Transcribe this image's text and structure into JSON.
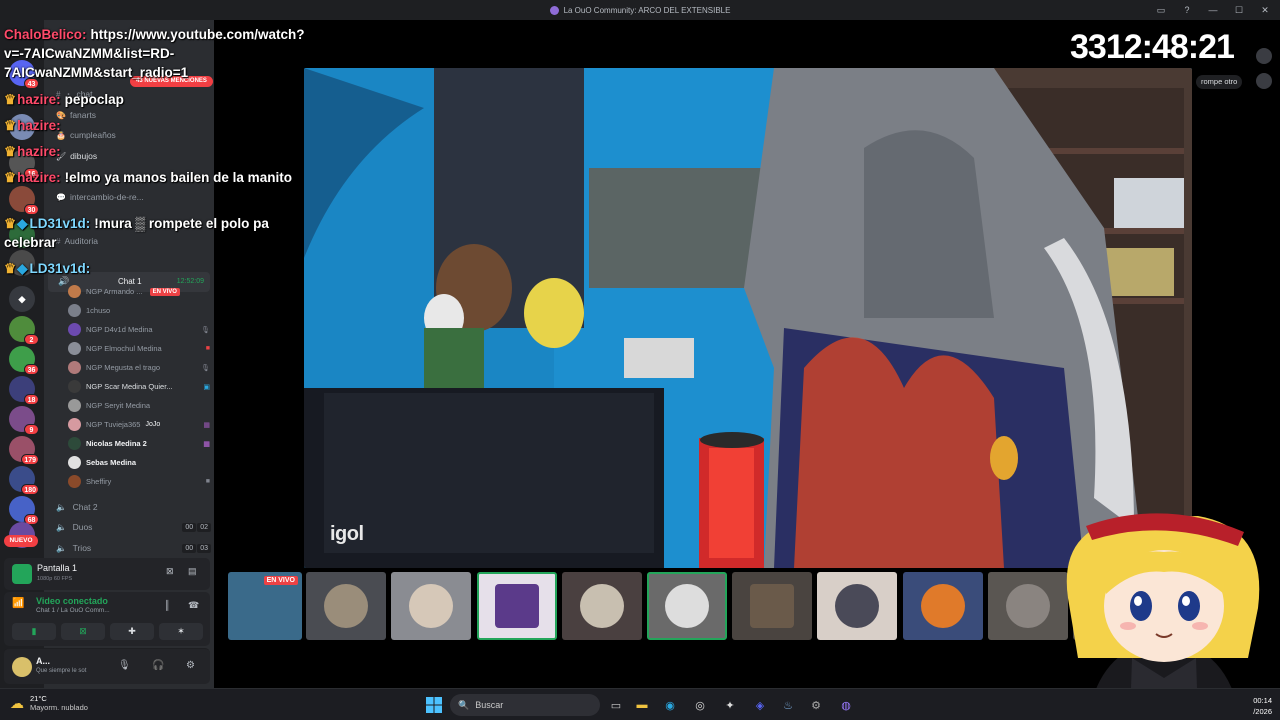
{
  "window": {
    "title": "La OuO Community: ARCO DEL EXTENSIBLE"
  },
  "rail": {
    "badges": [
      "43",
      "16",
      "30",
      "2",
      "36",
      "18",
      "9",
      "179",
      "180",
      "68"
    ],
    "new_label": "NUEVO"
  },
  "channels": {
    "mentions_label": "43 NUEVAS MENCIONES",
    "text_channels": [
      {
        "label": "chat",
        "prefix": "・"
      },
      {
        "label": "fanarts",
        "prefix": "・"
      },
      {
        "label": "cumpleaños",
        "prefix": "・"
      },
      {
        "label": "dibujos",
        "prefix": "・"
      },
      {
        "label": "intercambio-de-re...",
        "prefix": "・"
      },
      {
        "label": "Auditoria",
        "prefix": "・"
      }
    ],
    "voice_header": {
      "label": "Chat 1",
      "time": "12:52:09"
    },
    "voice_users": [
      {
        "name": "NGP Armando ...",
        "live": "EN VIVO"
      },
      {
        "name": "1chuso"
      },
      {
        "name": "NGP D4v1d Medina"
      },
      {
        "name": "NGP Elmochul Medina"
      },
      {
        "name": "NGP Megusta el trago"
      },
      {
        "name": "NGP Scar Medina Quier..."
      },
      {
        "name": "NGP Seryit Medina"
      },
      {
        "name": "NGP Tuvieja365",
        "tag": "JoJo"
      },
      {
        "name": "Nicolas Medina 2"
      },
      {
        "name": "Sebas Medina"
      },
      {
        "name": "Sheffiry"
      }
    ],
    "sub_voice": [
      {
        "label": "Chat 2",
        "count_a": "",
        "count_b": ""
      },
      {
        "label": "Duos",
        "count_a": "00",
        "count_b": "02"
      },
      {
        "label": "Trios",
        "count_a": "00",
        "count_b": "03"
      }
    ]
  },
  "stream_panel": {
    "title": "Pantalla 1",
    "sub": "1080p 60 FPS"
  },
  "voice_panel": {
    "title": "Video conectado",
    "sub": "Chat 1 / La OuO Comm..."
  },
  "user_panel": {
    "name": "A...",
    "status": "Que siempre le sot"
  },
  "overlay_chat": [
    {
      "name": "ChaloBelico:",
      "text": "https://www.youtube.com/watch?"
    },
    {
      "name": "",
      "text": "v=-7AICwaNZMM&list=RD-"
    },
    {
      "name": "",
      "text": "7AICwaNZMM&start_radio=1"
    },
    {
      "name": "hazire:",
      "text": "pepoclap"
    },
    {
      "name": "hazire:",
      "text": ""
    },
    {
      "name": "hazire:",
      "text": ""
    },
    {
      "name": "hazire:",
      "text": "!elmo ya manos bailen de la manito"
    },
    {
      "name": "LD31v1d:",
      "text": "!mura ▒ rompete el polo pa"
    },
    {
      "name": "",
      "text": "celebrar"
    },
    {
      "name": "LD31v1d:",
      "text": ""
    }
  ],
  "timer": "3312:48:21",
  "side_bubble": "rompe otro",
  "camera_label": "igol",
  "thumbnail_live": "EN VIVO",
  "taskbar": {
    "temp": "21°C",
    "weather": "Mayorm. nublado",
    "search_placeholder": "Buscar",
    "time": "00:14",
    "date": "/2026"
  },
  "colors": {
    "discord_dark": "#1e1f22",
    "panel": "#2b2d31",
    "live_red": "#ed4245",
    "online_green": "#23a55a",
    "wall_blue": "#1f9ad8"
  }
}
